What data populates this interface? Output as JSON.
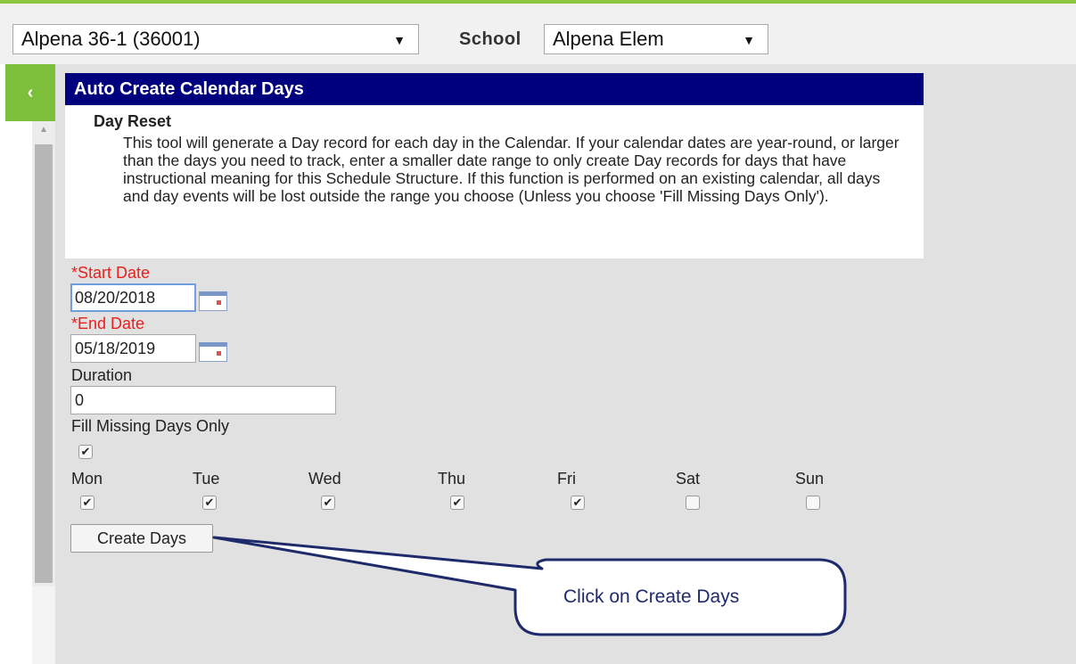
{
  "header": {
    "district_value": "Alpena 36-1 (36001)",
    "school_label": "School",
    "school_value": "Alpena Elem"
  },
  "sidebar": {
    "collapse_glyph": "‹"
  },
  "panel": {
    "title": "Auto Create Calendar Days",
    "section_heading": "Day Reset",
    "description": "This tool will generate a Day record for each day in the Calendar. If your calendar dates are year-round, or larger than the days you need to track, enter a smaller date range to only create Day records for days that have instructional meaning for this Schedule Structure. If this function is performed on an existing calendar, all days and day events will be lost outside the range you choose (Unless you choose 'Fill Missing Days Only')."
  },
  "form": {
    "required_marker": "*",
    "start_date_label": "Start Date",
    "start_date_value": "08/20/2018",
    "end_date_label": "End Date",
    "end_date_value": "05/18/2019",
    "duration_label": "Duration",
    "duration_value": "0",
    "fill_missing_label": "Fill Missing Days Only",
    "fill_missing_checked": true,
    "days": [
      {
        "label": "Mon",
        "checked": true
      },
      {
        "label": "Tue",
        "checked": true
      },
      {
        "label": "Wed",
        "checked": true
      },
      {
        "label": "Thu",
        "checked": true
      },
      {
        "label": "Fri",
        "checked": true
      },
      {
        "label": "Sat",
        "checked": false
      },
      {
        "label": "Sun",
        "checked": false
      }
    ],
    "create_button_label": "Create Days"
  },
  "callout": {
    "text": "Click on Create Days"
  },
  "colors": {
    "title_bar": "#00007f",
    "accent_green": "#7bbf3a",
    "required_red": "#e8201e",
    "callout_outline": "#1f2a6b"
  },
  "icons": {
    "dropdown": "chevron-down-icon",
    "calendar": "calendar-icon",
    "check": "check-icon"
  }
}
